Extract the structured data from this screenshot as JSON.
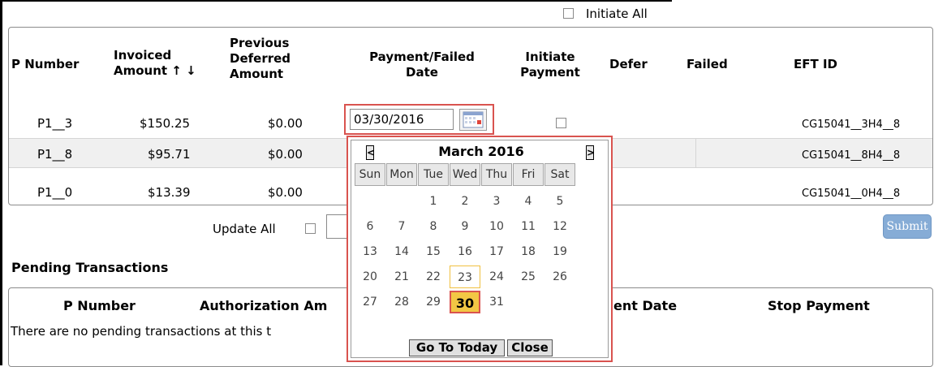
{
  "header": {
    "initiate_all_label": "Initiate All"
  },
  "columns": [
    "P Number",
    "Invoiced Amount ↑↓",
    "Previous Deferred Amount",
    "Payment/Failed Date",
    "Initiate Payment",
    "Defer",
    "Failed",
    "EFT ID"
  ],
  "columns_display": {
    "p_number": "P Number",
    "invoiced_1": "Invoiced",
    "invoiced_2": "Amount ↑ ↓",
    "prev_1": "Previous",
    "prev_2": "Deferred",
    "prev_3": "Amount",
    "pay_1": "Payment/Failed",
    "pay_2": "Date",
    "init_1": "Initiate",
    "init_2": "Payment",
    "defer": "Defer",
    "failed": "Failed",
    "eft": "EFT ID"
  },
  "rows": [
    {
      "p_number": "P1__3",
      "invoiced": "$150.25",
      "prev_deferred": "$0.00",
      "payment_date": "03/30/2016",
      "eft_id": "CG15041__3H4__8"
    },
    {
      "p_number": "P1__8",
      "invoiced": "$95.71",
      "prev_deferred": "$0.00",
      "eft_id": "CG15041__8H4__8"
    },
    {
      "p_number": "P1__0",
      "invoiced": "$13.39",
      "prev_deferred": "$0.00",
      "eft_id": "CG15041__0H4__8"
    }
  ],
  "update_all_label": "Update All",
  "submit_label": "Submit",
  "pending": {
    "title": "Pending Transactions",
    "col_p_number": "P Number",
    "col_auth_amount": "Authorization Am",
    "col_date": "ent Date",
    "col_stop": "Stop Payment",
    "empty_message": "There are no pending transactions at this t"
  },
  "calendar": {
    "month_label": "March 2016",
    "prev": "<",
    "next": ">",
    "days_of_week": [
      "Sun",
      "Mon",
      "Tue",
      "Wed",
      "Thu",
      "Fri",
      "Sat"
    ],
    "weeks": [
      [
        "",
        "",
        "1",
        "2",
        "3",
        "4",
        "5"
      ],
      [
        "6",
        "7",
        "8",
        "9",
        "10",
        "11",
        "12"
      ],
      [
        "13",
        "14",
        "15",
        "16",
        "17",
        "18",
        "19"
      ],
      [
        "20",
        "21",
        "22",
        "23",
        "24",
        "25",
        "26"
      ],
      [
        "27",
        "28",
        "29",
        "30",
        "31",
        "",
        ""
      ]
    ],
    "today": "23",
    "selected": "30",
    "go_to_today_label": "Go To Today",
    "close_label": "Close"
  },
  "colors": {
    "highlight": "#d9534f",
    "selected_day": "#f2c744",
    "submit_bg": "#86acd6",
    "row_alt": "#f0f0f0"
  }
}
